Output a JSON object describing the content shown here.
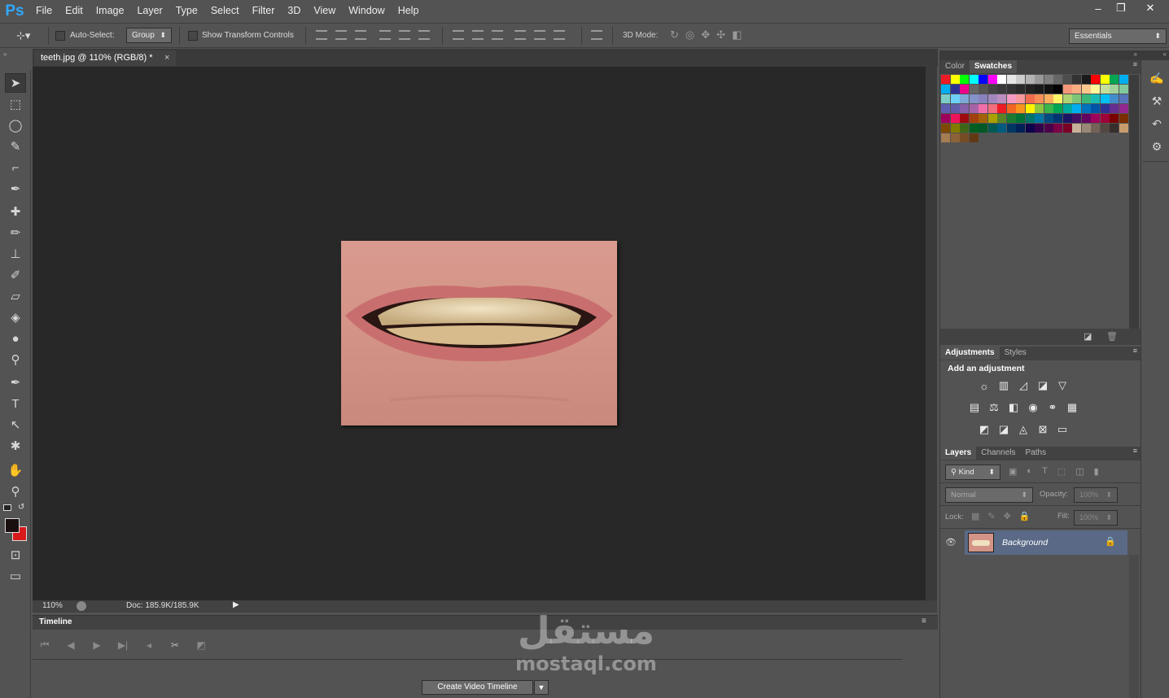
{
  "app": {
    "logo": "Ps",
    "menu": [
      "File",
      "Edit",
      "Image",
      "Layer",
      "Type",
      "Select",
      "Filter",
      "3D",
      "View",
      "Window",
      "Help"
    ]
  },
  "window": {
    "minimize": "–",
    "restore": "❐",
    "close": "✕"
  },
  "options": {
    "move_icon": "move-tool-icon",
    "auto_select_label": "Auto-Select:",
    "auto_select_value": "Group",
    "show_transform_label": "Show Transform Controls",
    "mode3d_label": "3D Mode:",
    "workspace": "Essentials"
  },
  "document": {
    "tab_title": "teeth.jpg @ 110% (RGB/8) *",
    "zoom": "110%",
    "doc_size": "Doc: 185.9K/185.9K"
  },
  "tools": [
    "move-tool-icon",
    "marquee-tool-icon",
    "lasso-tool-icon",
    "quick-select-tool-icon",
    "crop-tool-icon",
    "eyedropper-tool-icon",
    "healing-brush-icon",
    "brush-tool-icon",
    "clone-stamp-icon",
    "history-brush-icon",
    "eraser-tool-icon",
    "paint-bucket-icon",
    "blur-tool-icon",
    "dodge-tool-icon",
    "pen-tool-icon",
    "type-tool-icon",
    "path-select-icon",
    "custom-shape-icon",
    "hand-tool-icon",
    "zoom-tool-icon"
  ],
  "colors": {
    "foreground": "#1a0f0f",
    "background": "#d81a1a",
    "accent": "#31a8ff",
    "layer_selected": "#5a6a86"
  },
  "timeline": {
    "title": "Timeline",
    "create_button": "Create Video Timeline"
  },
  "panels": {
    "color_tabs": [
      "Color",
      "Swatches"
    ],
    "adjust_tabs": [
      "Adjustments",
      "Styles"
    ],
    "add_adjustment": "Add an adjustment",
    "layers_tabs": [
      "Layers",
      "Channels",
      "Paths"
    ],
    "kind_filter": "Kind",
    "blend_mode": "Normal",
    "opacity_label": "Opacity:",
    "opacity_value": "100%",
    "lock_label": "Lock:",
    "fill_label": "Fill:",
    "fill_value": "100%",
    "layer_name": "Background"
  },
  "swatches": [
    [
      "#ed1c24",
      "#ffff00",
      "#00ff00",
      "#00ffff",
      "#0000ff",
      "#ff00ff",
      "#ffffff",
      "#e6e6e6",
      "#cccccc",
      "#b3b3b3",
      "#999999",
      "#808080",
      "#666666",
      "#4d4d4d",
      "#333333",
      "#1a1a1a",
      "#ff0000",
      "#ffff00",
      "#00a651",
      "#00aeef"
    ],
    [
      "#00aeef",
      "#2e3192",
      "#ec008c",
      "#666666",
      "#555555",
      "#444444",
      "#3a3a3a",
      "#333333",
      "#2a2a2a",
      "#222222",
      "#1a1a1a",
      "#111111",
      "#000000",
      "#f7977a",
      "#f9ad81",
      "#fdc68a",
      "#fff79a",
      "#c4df9b",
      "#a3d39c",
      "#82ca9d"
    ],
    [
      "#7bcdc8",
      "#6ecff6",
      "#7ea7d8",
      "#8493ca",
      "#8882be",
      "#a187be",
      "#bc8dbf",
      "#f49ac2",
      "#f6989d",
      "#f26c4f",
      "#f68e55",
      "#fbaf5d",
      "#fff467",
      "#acd372",
      "#7cc576",
      "#3bb878",
      "#1abbb4",
      "#00bff3",
      "#438ccb",
      "#5574b9"
    ],
    [
      "#5e5eb0",
      "#605ca8",
      "#855fa8",
      "#a763a8",
      "#f06eaa",
      "#f26d7d",
      "#ed1c24",
      "#f26522",
      "#f7941d",
      "#fff200",
      "#8dc73f",
      "#39b54a",
      "#00a651",
      "#00a99d",
      "#00aeef",
      "#0072bc",
      "#0054a6",
      "#2e3192",
      "#662d91",
      "#92278f"
    ],
    [
      "#9e005d",
      "#ed145b",
      "#9e0b0f",
      "#a0410d",
      "#a36209",
      "#aba000",
      "#598527",
      "#1a7b30",
      "#007236",
      "#00746b",
      "#0076a3",
      "#004b80",
      "#003471",
      "#1b1464",
      "#440e62",
      "#630460",
      "#9e005d",
      "#9e0039",
      "#790000",
      "#7b2e00"
    ],
    [
      "#7d4900",
      "#827b00",
      "#406618",
      "#005e20",
      "#005826",
      "#005952",
      "#005b7f",
      "#003663",
      "#002157",
      "#0d004c",
      "#32004b",
      "#4b0049",
      "#7b0046",
      "#7a0026",
      "#c7b299",
      "#998675",
      "#736357",
      "#534741",
      "#362f2d",
      "#c69c6d"
    ],
    [
      "#a67c52",
      "#8c6239",
      "#754c24",
      "#603913"
    ]
  ]
}
